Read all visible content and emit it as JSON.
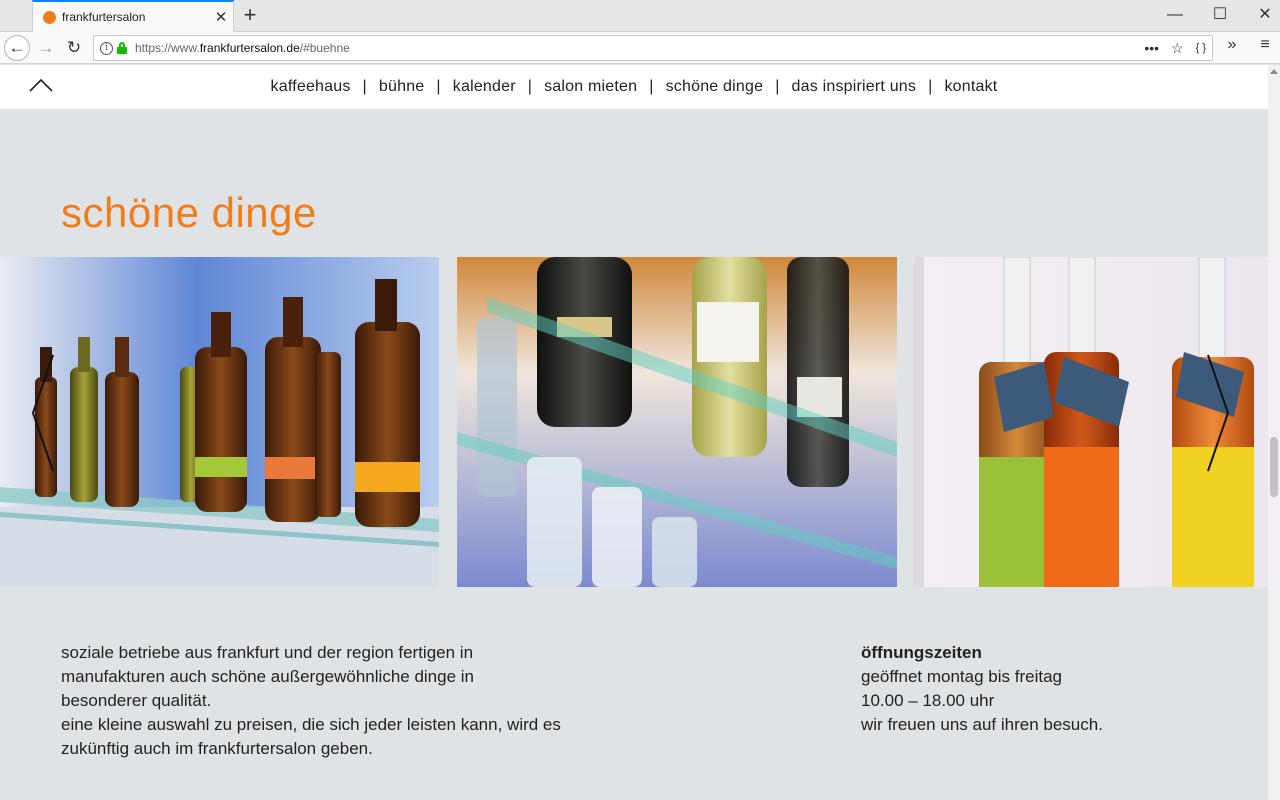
{
  "browser": {
    "tab_title": "frankfurtersalon",
    "tab_close": "✕",
    "new_tab": "+",
    "url_prefix": "https://www.",
    "url_domain": "frankfurtersalon.de",
    "url_path": "/#buehne",
    "url_actions": {
      "more_icon": "•••",
      "bookmark_icon": "☆",
      "reader_icon": "{ }"
    },
    "window_controls": {
      "minimize": "—",
      "maximize": "☐",
      "close": "✕"
    },
    "nav": {
      "back": "←",
      "forward": "→",
      "reload": "↻",
      "overflow": "»",
      "menu": "≡"
    }
  },
  "site": {
    "nav_items": [
      {
        "label": "kaffeehaus"
      },
      {
        "label": "bühne"
      },
      {
        "label": "kalender"
      },
      {
        "label": "salon mieten"
      },
      {
        "label": "schöne dinge"
      },
      {
        "label": "das inspiriert uns"
      },
      {
        "label": "kontakt"
      }
    ],
    "separator": "|",
    "heading": "schöne dinge",
    "description": [
      "soziale betriebe aus frankfurt und der region fertigen in",
      "manufakturen auch schöne außergewöhnliche dinge in",
      "besonderer qualität.",
      "eine kleine auswahl zu preisen, die sich jeder leisten kann, wird es",
      "zukünftig auch im frankfurtersalon geben."
    ],
    "hours": {
      "title": "öffnungszeiten",
      "line1": "geöffnet montag bis freitag",
      "line2": "10.00 – 18.00 uhr",
      "line3": "wir freuen uns auf ihren besuch."
    }
  },
  "colors": {
    "accent": "#f07d1a",
    "page_bg": "#dfe3e6"
  }
}
